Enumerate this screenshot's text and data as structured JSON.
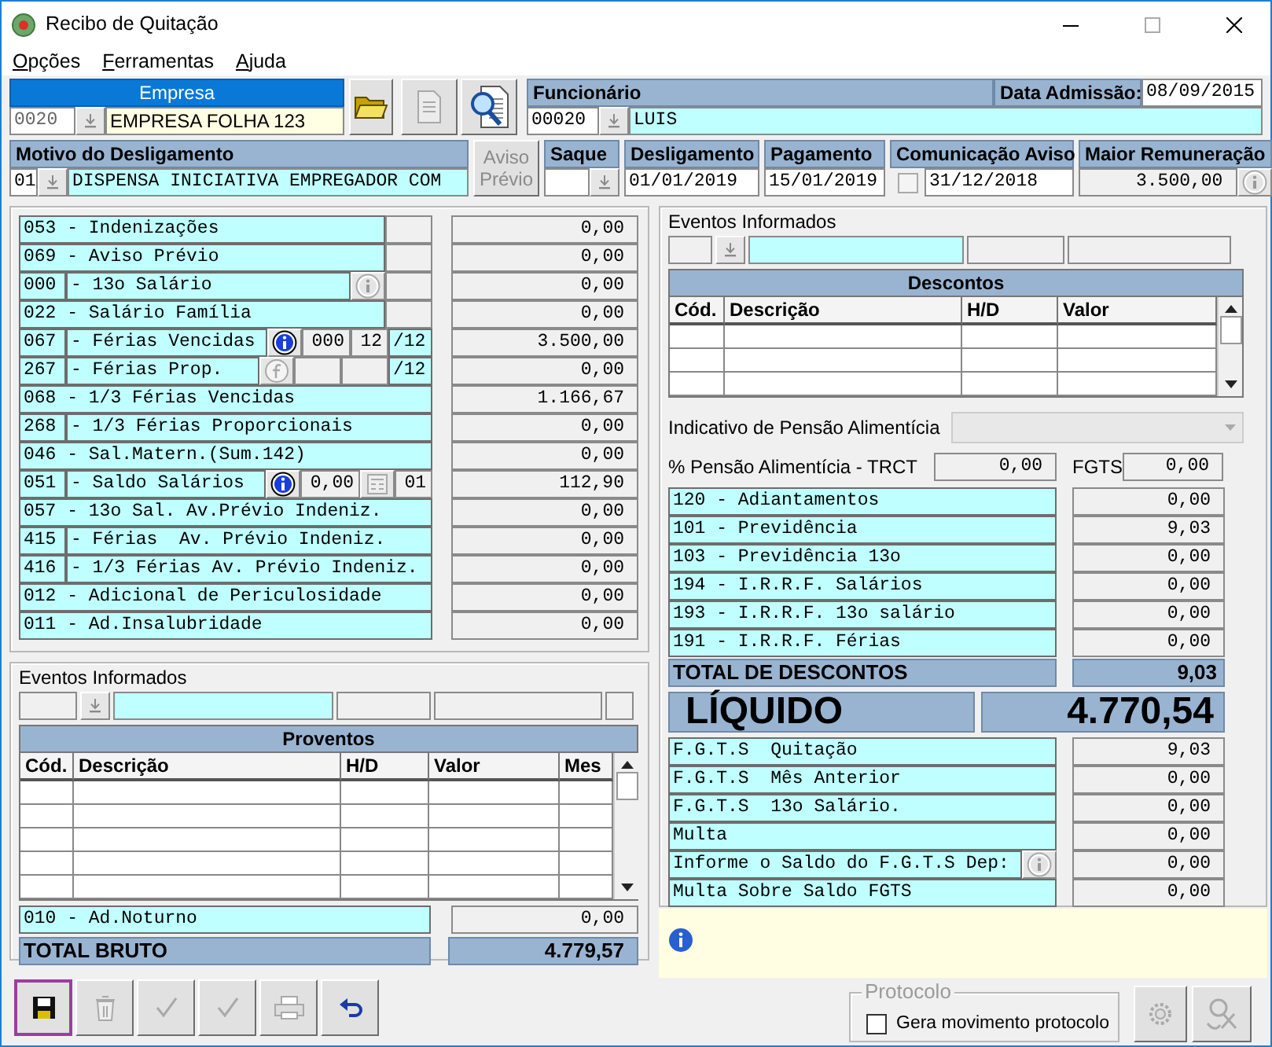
{
  "window": {
    "title": "Recibo de Quitação"
  },
  "menu": [
    "Opções",
    "Ferramentas",
    "Ajuda"
  ],
  "empresa": {
    "title": "Empresa",
    "code": "0020",
    "name": "EMPRESA FOLHA 123"
  },
  "top_buttons": [
    {
      "kind": "open",
      "disabled": false
    },
    {
      "kind": "document",
      "disabled": true
    },
    {
      "kind": "search",
      "disabled": false
    }
  ],
  "funcionario": {
    "title": "Funcionário",
    "code": "00020",
    "name": "LUIS"
  },
  "data_admissao": {
    "label": "Data Admissão:",
    "value": "08/09/2015"
  },
  "motivo": {
    "title": "Motivo do Desligamento",
    "code": "01",
    "text": "DISPENSA INICIATIVA EMPREGADOR COM"
  },
  "aviso_previo": {
    "label": "Aviso Prévio",
    "disabled": true
  },
  "saque": {
    "title": "Saque"
  },
  "desligamento": {
    "title": "Desligamento",
    "value": "01/01/2019"
  },
  "pagamento": {
    "title": "Pagamento",
    "value": "15/01/2019"
  },
  "comunicacao_aviso": {
    "title": "Comunicação Aviso",
    "checked": false,
    "value": "31/12/2018"
  },
  "maior_remuneracao": {
    "title": "Maior Remuneração",
    "value": "3.500,00",
    "info_disabled": true
  },
  "proventos_items": [
    {
      "label": "053 - Indenizações",
      "extras": [
        {
          "kind": "blank"
        }
      ],
      "value": "0,00"
    },
    {
      "label": "069 - Aviso Prévio",
      "extras": [
        {
          "kind": "blank"
        }
      ],
      "value": "0,00"
    },
    {
      "code": "000",
      "label": "- 13o Salário",
      "extras": [
        {
          "kind": "info",
          "disabled": true
        },
        {
          "kind": "blank"
        }
      ],
      "value": "0,00"
    },
    {
      "label": "022 - Salário Família",
      "extras": [
        {
          "kind": "blank"
        }
      ],
      "value": "0,00"
    },
    {
      "code": "067",
      "label": "- Férias Vencidas",
      "extras": [
        {
          "kind": "info",
          "disabled": false
        },
        {
          "kind": "field",
          "text": "000"
        },
        {
          "kind": "field",
          "text": "12"
        },
        {
          "kind": "suffix",
          "text": "/12"
        }
      ],
      "value": "3.500,00"
    },
    {
      "code": "267",
      "label": "- Férias Prop.",
      "extras": [
        {
          "kind": "formula",
          "disabled": true
        },
        {
          "kind": "blank"
        },
        {
          "kind": "blank"
        },
        {
          "kind": "suffix",
          "text": "/12"
        }
      ],
      "value": "0,00"
    },
    {
      "label": "068 - 1/3 Férias Vencidas",
      "value": "1.166,67"
    },
    {
      "code": "268",
      "label": "- 1/3 Férias Proporcionais",
      "value": "0,00"
    },
    {
      "label": "046 - Sal.Matern.(Sum.142)",
      "value": "0,00"
    },
    {
      "code": "051",
      "label": "- Saldo Salários",
      "extras": [
        {
          "kind": "info",
          "disabled": false
        },
        {
          "kind": "field",
          "text": "0,00"
        },
        {
          "kind": "calc",
          "disabled": true
        },
        {
          "kind": "field",
          "text": "01"
        }
      ],
      "value": "112,90"
    },
    {
      "label": "057 - 13o Sal. Av.Prévio Indeniz.",
      "value": "0,00"
    },
    {
      "code": "415",
      "label": "- Férias  Av. Prévio Indeniz.",
      "value": "0,00"
    },
    {
      "code": "416",
      "label": "- 1/3 Férias Av. Prévio Indeniz.",
      "value": "0,00"
    },
    {
      "label": "012 - Adicional de Periculosidade",
      "value": "0,00"
    },
    {
      "label": "011 - Ad.Insalubridade",
      "value": "0,00"
    }
  ],
  "eventos_proventos": {
    "title": "Eventos Informados",
    "grid_title": "Proventos",
    "columns": [
      "Cód.",
      "Descrição",
      "H/D",
      "Valor",
      "Mes"
    ]
  },
  "extra_provento": {
    "label": "010 - Ad.Noturno",
    "value": "0,00"
  },
  "total_bruto": {
    "label": "TOTAL BRUTO",
    "value": "4.779,57"
  },
  "toolbar": [
    {
      "kind": "save",
      "disabled": false,
      "focused": true
    },
    {
      "kind": "delete",
      "disabled": true,
      "focused": false
    },
    {
      "kind": "check",
      "disabled": true,
      "focused": false
    },
    {
      "kind": "check",
      "disabled": true,
      "focused": false
    },
    {
      "kind": "print",
      "disabled": true,
      "focused": false
    },
    {
      "kind": "undo",
      "disabled": false,
      "focused": false
    }
  ],
  "eventos_descontos": {
    "title": "Eventos Informados",
    "grid_title": "Descontos",
    "columns": [
      "Cód.",
      "Descrição",
      "H/D",
      "Valor"
    ]
  },
  "pensao": {
    "indicativo_label": "Indicativo de Pensão Alimentícia",
    "indicativo_disabled": true,
    "percent_label": "% Pensão Alimentícia - TRCT",
    "percent_value": "0,00",
    "fgts_label": "FGTS",
    "fgts_value": "0,00"
  },
  "descontos_items": [
    {
      "label": "120 - Adiantamentos",
      "value": "0,00"
    },
    {
      "label": "101 - Previdência",
      "value": "9,03"
    },
    {
      "label": "103 - Previdência 13o",
      "value": "0,00"
    },
    {
      "label": "194 - I.R.R.F. Salários",
      "value": "0,00"
    },
    {
      "label": "193 - I.R.R.F. 13o salário",
      "value": "0,00"
    },
    {
      "label": "191 - I.R.R.F. Férias",
      "value": "0,00"
    }
  ],
  "total_descontos": {
    "label": "TOTAL DE DESCONTOS",
    "value": "9,03"
  },
  "liquido": {
    "label": "LÍQUIDO",
    "value": "4.770,54"
  },
  "fgts_items": [
    {
      "label": "F.G.T.S  Quitação",
      "value": "9,03"
    },
    {
      "label": "F.G.T.S  Mês Anterior",
      "value": "0,00"
    },
    {
      "label": "F.G.T.S  13o Salário.",
      "value": "0,00"
    },
    {
      "label": "Multa",
      "value": "0,00"
    },
    {
      "label": "Informe o Saldo do F.G.T.S Dep:",
      "info": true,
      "value": "0,00"
    },
    {
      "label": "Multa Sobre Saldo FGTS",
      "value": "0,00"
    }
  ],
  "protocolo": {
    "title": "Protocolo",
    "checkbox_label": "Gera movimento protocolo",
    "checked": false
  },
  "bottom_buttons": [
    {
      "kind": "gear",
      "disabled": true
    },
    {
      "kind": "tool",
      "disabled": true
    }
  ]
}
